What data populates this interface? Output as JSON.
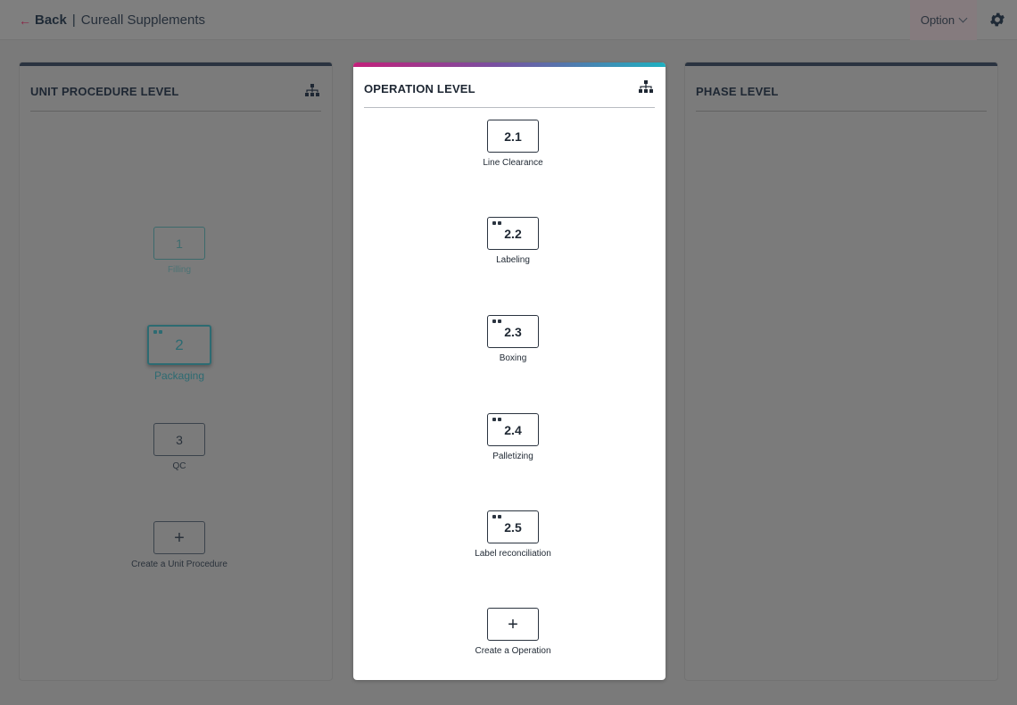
{
  "header": {
    "back_label": "Back",
    "separator": "|",
    "company": "Cureall Supplements",
    "option_label": "Option"
  },
  "icons": {
    "back": "arrow-left-icon",
    "option": "chevron-down-icon",
    "settings": "gear-icon",
    "hierarchy": "hierarchy-icon",
    "link": "link-icon",
    "add": "plus-icon"
  },
  "colors": {
    "accent_gradient": [
      "#c2207a",
      "#7a4fa0",
      "#1eb0c0"
    ],
    "active_teal": "#2d6b72",
    "back_arrow": "#8a2546"
  },
  "panels": {
    "unit_procedure": {
      "title": "UNIT PROCEDURE LEVEL",
      "items": [
        {
          "number": "1",
          "label": "Filling"
        },
        {
          "number": "2",
          "label": "Packaging"
        },
        {
          "number": "3",
          "label": "QC"
        }
      ],
      "create_label": "Create a Unit Procedure"
    },
    "operation": {
      "title": "OPERATION LEVEL",
      "items": [
        {
          "number": "2.1",
          "label": "Line Clearance"
        },
        {
          "number": "2.2",
          "label": "Labeling"
        },
        {
          "number": "2.3",
          "label": "Boxing"
        },
        {
          "number": "2.4",
          "label": "Palletizing"
        },
        {
          "number": "2.5",
          "label": "Label reconciliation"
        }
      ],
      "create_label": "Create a Operation"
    },
    "phase": {
      "title": "PHASE LEVEL"
    }
  }
}
